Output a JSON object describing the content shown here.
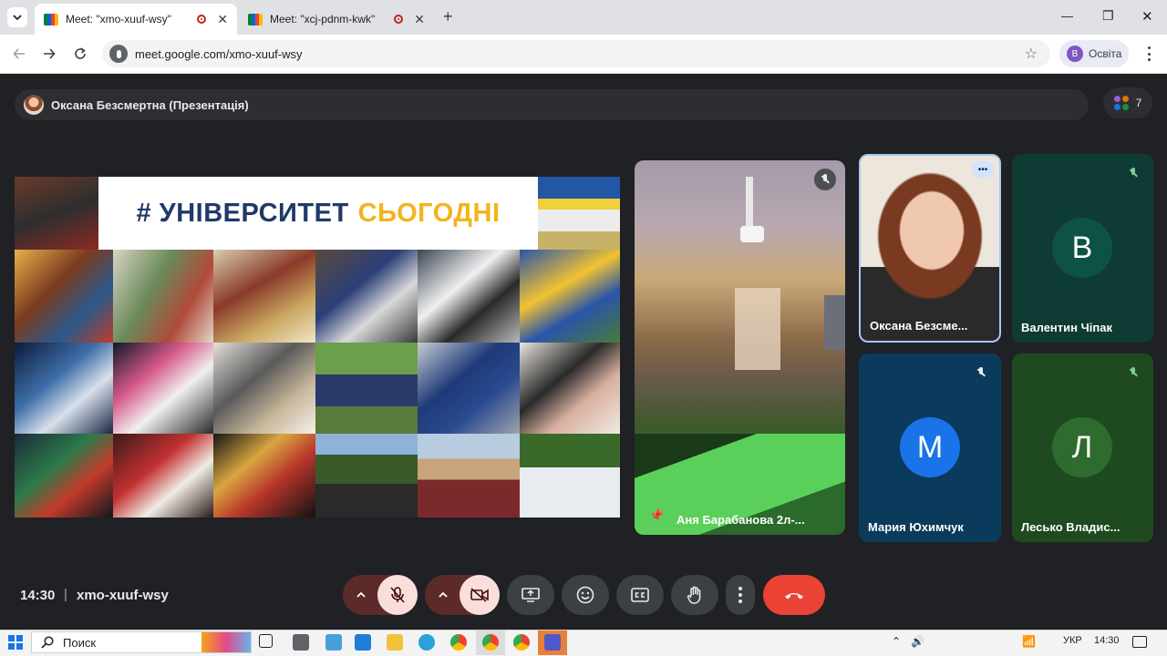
{
  "browser": {
    "tabs": [
      {
        "title": "Meet: \"xmo-xuuf-wsy\"",
        "active": true
      },
      {
        "title": "Meet: \"xcj-pdnm-kwk\"",
        "active": false
      }
    ],
    "new_tab": "+",
    "address": "meet.google.com/xmo-xuuf-wsy",
    "profile_initial": "B",
    "profile_name": "Освіта",
    "window_controls": {
      "minimize": "—",
      "restore": "❐",
      "close": "✕"
    }
  },
  "meet": {
    "presenter_label": "Оксана Безсмертна (Презентація)",
    "participant_count": "7",
    "slide": {
      "title_part1": "# УНІВЕРСИТЕТ",
      "title_part2": "СЬОГОДНІ"
    },
    "tiles": [
      {
        "name": "Аня Барабанова 2л-...",
        "pinned": true,
        "muted": true
      },
      {
        "name": "Оксана Безсме...",
        "active_speaker": true
      },
      {
        "name": "Валентин Чіпак",
        "initial": "В",
        "muted": true
      },
      {
        "name": "Мария Юхимчук",
        "initial": "М",
        "muted": true
      },
      {
        "name": "Лесько Владис...",
        "initial": "Л",
        "muted": true
      }
    ],
    "more_options_icon": "•••",
    "time": "14:30",
    "separator": "|",
    "meeting_code": "xmo-xuuf-wsy"
  },
  "taskbar": {
    "search_placeholder": "Поиск",
    "language": "УКР",
    "clock": "14:30"
  },
  "colors": {
    "meet_bg": "#202124",
    "danger": "#ea4335",
    "muted_red": "#f9dedc",
    "slide_blue": "#1f3a68",
    "slide_yellow": "#f3b41b"
  }
}
